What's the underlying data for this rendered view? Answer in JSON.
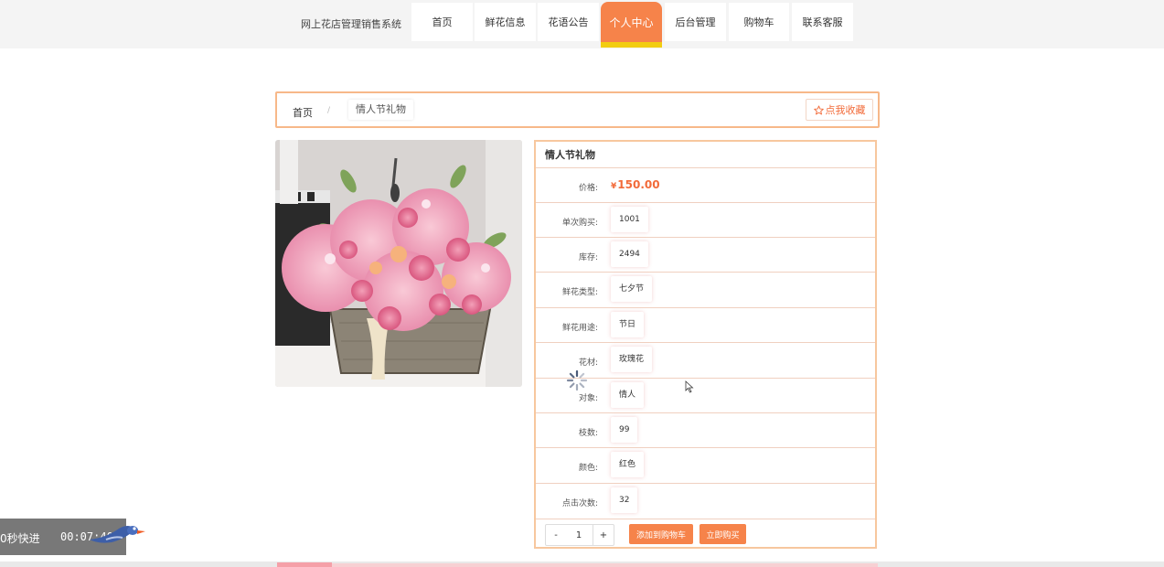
{
  "header": {
    "site_title": "网上花店管理销售系统",
    "nav": [
      {
        "label": "首页"
      },
      {
        "label": "鲜花信息"
      },
      {
        "label": "花语公告"
      },
      {
        "label": "个人中心"
      },
      {
        "label": "后台管理"
      },
      {
        "label": "购物车"
      },
      {
        "label": "联系客服"
      }
    ],
    "active_nav": "个人中心",
    "accent_color": "#f6834a",
    "underline_color": "#f2cd10"
  },
  "breadcrumb": {
    "home": "首页",
    "separator": "/",
    "current": "情人节礼物",
    "favorite_label": "点我收藏"
  },
  "product": {
    "title": "情人节礼物",
    "price_symbol": "¥",
    "price": "150.00",
    "fields": [
      {
        "label": "单次购买:",
        "value": "1001"
      },
      {
        "label": "库存:",
        "value": "2494"
      },
      {
        "label": "鲜花类型:",
        "value": "七夕节"
      },
      {
        "label": "鲜花用途:",
        "value": "节日"
      },
      {
        "label": "花材:",
        "value": "玫瑰花"
      },
      {
        "label": "对象:",
        "value": "情人"
      },
      {
        "label": "枝数:",
        "value": "99"
      },
      {
        "label": "颜色:",
        "value": "红色"
      },
      {
        "label": "点击次数:",
        "value": "32"
      }
    ],
    "price_label": "价格:"
  },
  "purchase": {
    "minus": "-",
    "quantity": "1",
    "plus": "+",
    "add_to_cart": "添加到购物车",
    "buy_now": "立即购买"
  },
  "video_overlay": {
    "fast_forward": "0秒快进",
    "time": "00:07:40"
  }
}
